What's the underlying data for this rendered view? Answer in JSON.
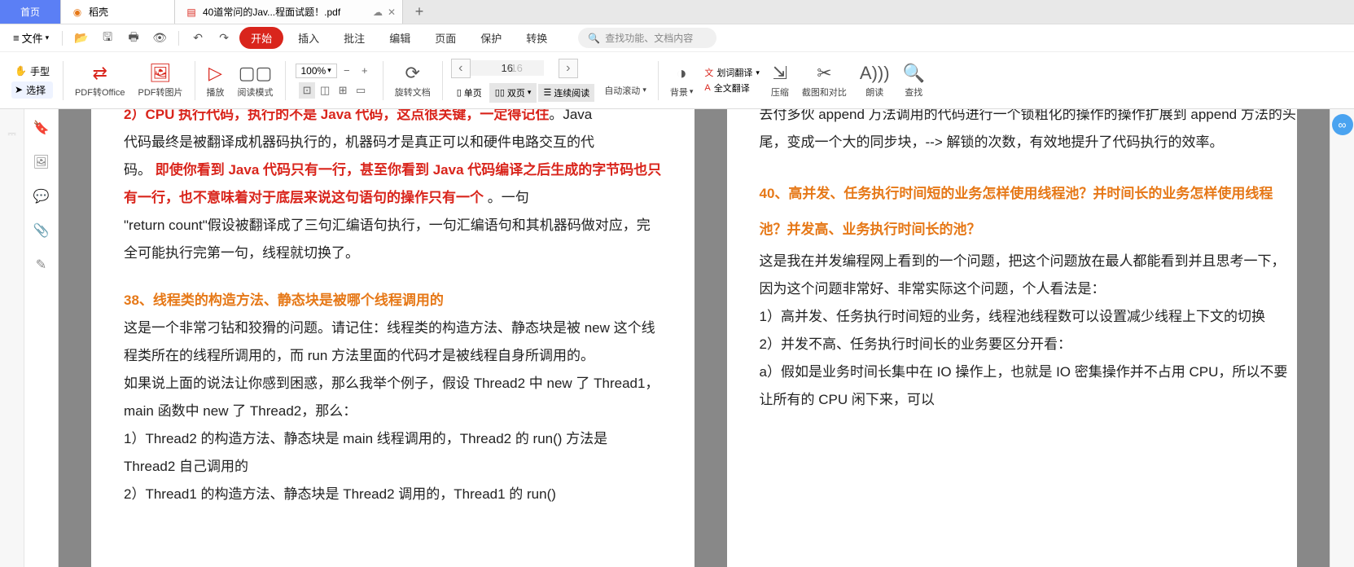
{
  "tabs": {
    "home": "首页",
    "daoke": "稻壳",
    "file_tab": "40道常问的Jav...程面试题！.pdf",
    "add": "+"
  },
  "file_menu_label": "文件",
  "menu": {
    "start": "开始",
    "insert": "插入",
    "comment": "批注",
    "edit": "编辑",
    "page": "页面",
    "protect": "保护",
    "convert": "转换"
  },
  "search_placeholder": "查找功能、文档内容",
  "hand_label": "手型",
  "select_label": "选择",
  "toolbar": {
    "pdf_to_office": "PDF转Office",
    "pdf_to_image": "PDF转图片",
    "play": "播放",
    "read_mode": "阅读模式",
    "zoom_value": "100%",
    "rotate_doc": "旋转文档",
    "single_page": "单页",
    "double_page": "双页",
    "continuous_read": "连续阅读",
    "auto_scroll": "自动滚动",
    "background": "背景",
    "word_translate": "划词翻译",
    "full_translate": "全文翻译",
    "compress": "压缩",
    "screenshot_compare": "截图和对比",
    "read_aloud": "朗读",
    "find": "查找",
    "page_current": "16",
    "page_total": "/16"
  },
  "doc_left": {
    "line1_prefix": "码。",
    "line1_red": "即使你看到 Java 代码只有一行，甚至你看到 Java 代码编译之后生成的字节码也只有一行，也不意味着对于底层来说这句语句的操作只有一个",
    "line1_suffix": "。一句",
    "line0a": "代码最终是被翻译成机器码执行的，机器码才是真正可以和硬件电路交互的代",
    "line2": "\"return count\"假设被翻译成了三句汇编语句执行，一句汇编语句和其机器码做对应，完全可能执行完第一句，线程就切换了。",
    "h38": "38、线程类的构造方法、静态块是被哪个线程调用的",
    "p38a": "这是一个非常刁钻和狡猾的问题。请记住：线程类的构造方法、静态块是被 new 这个线程类所在的线程所调用的，而 run 方法里面的代码才是被线程自身所调用的。",
    "p38b": "如果说上面的说法让你感到困惑，那么我举个例子，假设 Thread2 中 new 了 Thread1，main 函数中 new 了 Thread2，那么：",
    "p38c": "1）Thread2 的构造方法、静态块是 main 线程调用的，Thread2 的 run() 方法是 Thread2 自己调用的",
    "p38d": "2）Thread1 的构造方法、静态块是 Thread2 调用的，Thread1 的 run()"
  },
  "doc_right": {
    "frag0": "去付多伙 append 万法调用的代码进行一个锁粗化的操作的操作扩展到 append 方法的头尾，变成一个大的同步块，--> 解锁的次数，有效地提升了代码执行的效率。",
    "h40": "40、高并发、任务执行时间短的业务怎样使用线程池？并时间长的业务怎样使用线程池？并发高、业务执行时间长的池？",
    "p40a": "这是我在并发编程网上看到的一个问题，把这个问题放在最人都能看到并且思考一下，因为这个问题非常好、非常实际这个问题，个人看法是：",
    "p40b": "1）高并发、任务执行时间短的业务，线程池线程数可以设置减少线程上下文的切换",
    "p40c": "2）并发不高、任务执行时间长的业务要区分开看：",
    "p40d": "a）假如是业务时间长集中在 IO 操作上，也就是 IO 密集操作并不占用 CPU，所以不要让所有的 CPU 闲下来，可以"
  }
}
